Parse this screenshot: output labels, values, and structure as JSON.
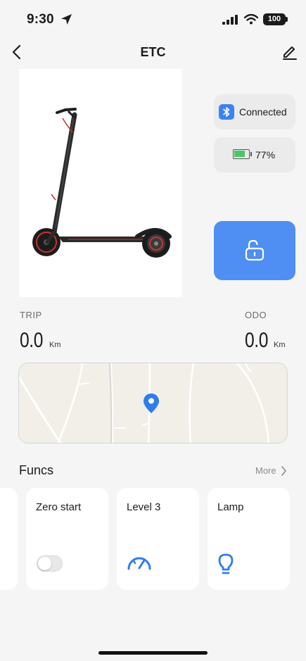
{
  "status_bar": {
    "time": "9:30",
    "battery": "100"
  },
  "nav": {
    "title": "ETC"
  },
  "device": {
    "connection_status": "Connected",
    "battery_percent": "77%",
    "battery_level": 0.77
  },
  "stats": {
    "trip_label": "TRIP",
    "trip_value": "0.0",
    "trip_unit": "Km",
    "odo_label": "ODO",
    "odo_value": "0.0",
    "odo_unit": "Km"
  },
  "funcs": {
    "title": "Funcs",
    "more_label": "More",
    "items": [
      {
        "label": "Zero start",
        "icon": "toggle-switch",
        "enabled": false
      },
      {
        "label": "Level 3",
        "icon": "speedometer-icon"
      },
      {
        "label": "Lamp",
        "icon": "lightbulb-icon"
      }
    ]
  },
  "colors": {
    "accent": "#4f8ff3",
    "bluetooth": "#3b82f6",
    "battery_fill": "#4cc46a",
    "background": "#f5f5f5"
  }
}
